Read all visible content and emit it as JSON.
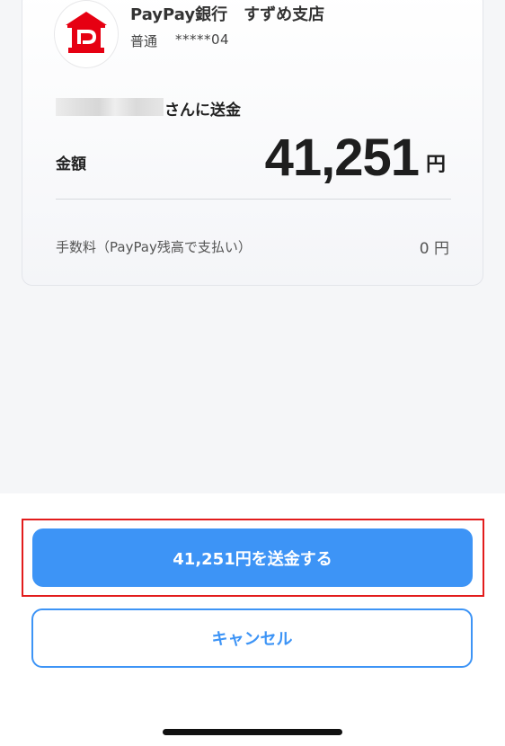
{
  "bank": {
    "name": "PayPay銀行　すずめ支店",
    "account_type": "普通",
    "account_number": "*****04",
    "logo_icon": "paypay-bank-logo-icon",
    "brand_color": "#e60012"
  },
  "recipient": {
    "suffix": "さんに送金"
  },
  "amount": {
    "label": "金額",
    "value": "41,251",
    "unit": "円"
  },
  "fee": {
    "label": "手数料（PayPay残高で支払い）",
    "value": "0 円"
  },
  "actions": {
    "send_label": "41,251円を送金する",
    "cancel_label": "キャンセル",
    "accent_color": "#3d94f6",
    "highlight_color": "#e21c1c"
  }
}
